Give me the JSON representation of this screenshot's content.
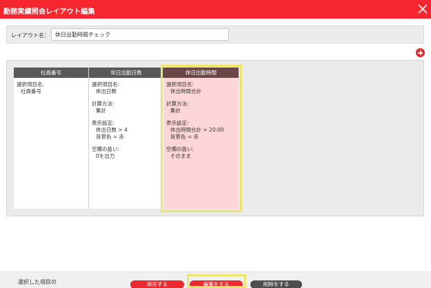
{
  "titlebar": {
    "title": "勤務実績照会レイアウト編集",
    "close_icon": "close-icon",
    "background": "#f5262e"
  },
  "layout_name": {
    "label": "レイアウト名：",
    "value": "休日出勤時間チェック"
  },
  "add_button": {
    "icon": "plus-circle-icon"
  },
  "columns": [
    {
      "header": "社員番号",
      "item_label": "選択項目名:",
      "item_value": "社員番号"
    },
    {
      "header": "休日出勤日数",
      "item_label": "選択項目名:",
      "item_value": "休出日数",
      "calc_label": "計算方法:",
      "calc_value": "集計",
      "display_label": "表示設定:",
      "display_line1": "休出日数 > 4",
      "display_line2": "背景色 = 赤",
      "blank_label": "空欄の扱い:",
      "blank_value": "0を出力"
    },
    {
      "header": "休日出勤時間",
      "item_label": "選択項目名:",
      "item_value": "休出時間合計",
      "calc_label": "計算方法:",
      "calc_value": "集計",
      "display_label": "表示設定:",
      "display_line1": "休出時間合計 > 20:00",
      "display_line2": "背景色 = 赤",
      "blank_label": "空欄の扱い:",
      "blank_value": "そのまま"
    }
  ],
  "footer": {
    "status": "選択した項目の",
    "save_label": "保存する",
    "edit_label": "編集をする",
    "delete_label": "削除をする"
  },
  "colors": {
    "accent": "#ea2a2e",
    "selected_column": "#fdd6d8",
    "highlight": "#ede56a"
  }
}
